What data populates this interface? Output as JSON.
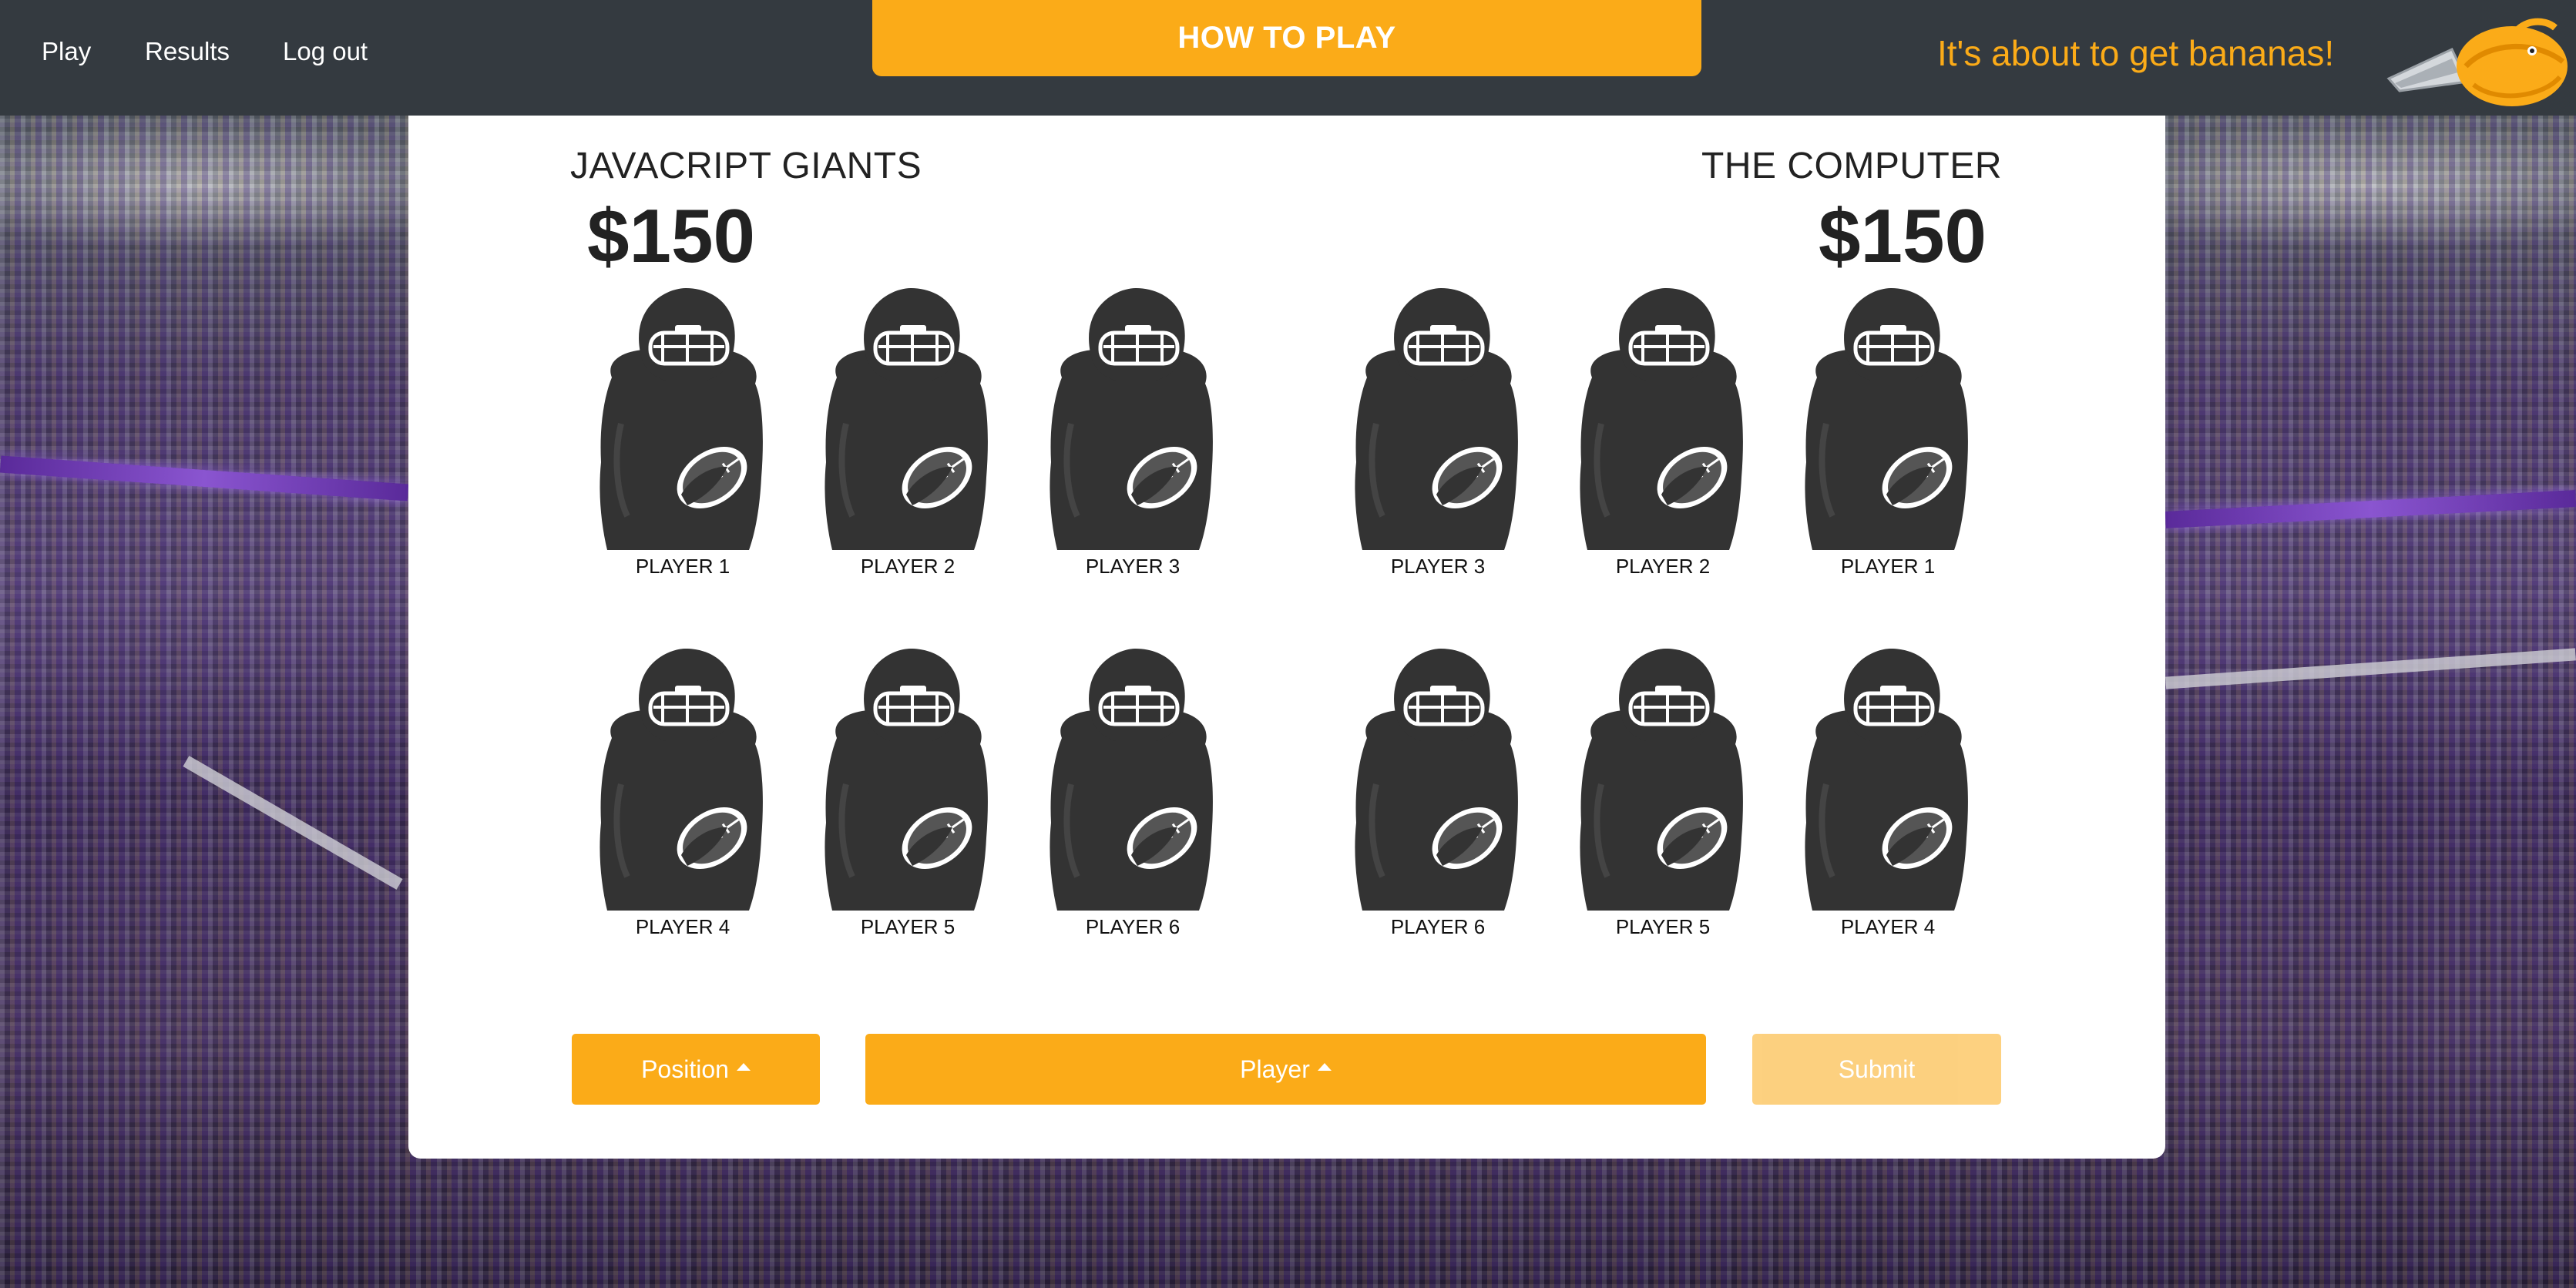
{
  "nav": {
    "links": [
      {
        "label": "Play"
      },
      {
        "label": "Results"
      },
      {
        "label": "Log out"
      }
    ],
    "how_to_play": "HOW TO PLAY",
    "tagline": "It's about to get bananas!"
  },
  "colors": {
    "accent": "#fbab18",
    "navbar": "#343a40",
    "card": "#ffffff",
    "text": "#222222",
    "player_silhouette": "#333333"
  },
  "teams": {
    "home": {
      "name": "JAVACRIPT GIANTS",
      "money": "$150",
      "players": [
        "PLAYER 1",
        "PLAYER 2",
        "PLAYER 3",
        "PLAYER 4",
        "PLAYER 5",
        "PLAYER 6"
      ]
    },
    "away": {
      "name": "THE COMPUTER",
      "money": "$150",
      "players": [
        "PLAYER 3",
        "PLAYER 2",
        "PLAYER 1",
        "PLAYER 6",
        "PLAYER 5",
        "PLAYER 4"
      ]
    }
  },
  "controls": {
    "position_label": "Position",
    "player_label": "Player",
    "submit_label": "Submit"
  },
  "icons": {
    "player": "football-player-icon",
    "logo": "banana-football-logo-icon",
    "dropdown_caret": "caret-up-icon"
  }
}
